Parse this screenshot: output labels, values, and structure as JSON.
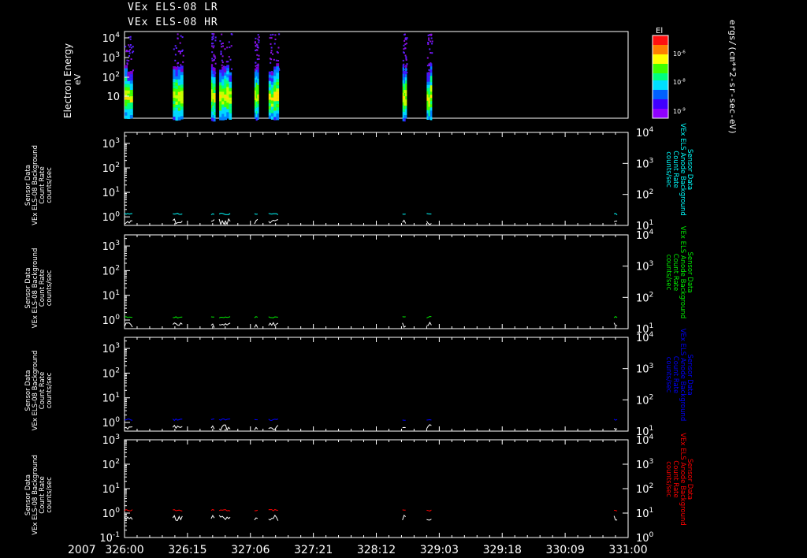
{
  "header": {
    "line1": "VEx ELS-08 LR",
    "line2": "VEx ELS-08 HR"
  },
  "colors": {
    "background": "#000000",
    "axis": "#ffffff",
    "cyan": "#00ffff",
    "green": "#00ee00",
    "blue": "#0000ff",
    "red": "#ff0000"
  },
  "chart_data": [
    {
      "type": "heatmap",
      "ylabel": "Electron Energy",
      "yunit": "eV",
      "scale": "log",
      "yticks": [
        "10",
        "10^2",
        "10^3",
        "10^4"
      ],
      "colorbar": {
        "title": "El",
        "units": "ergs/(cm**2-sr-sec-eV)",
        "ticks": [
          "10^-6",
          "10^-8",
          "10^-9"
        ]
      },
      "intervals": [
        [
          326.0,
          326.08
        ],
        [
          326.48,
          326.58
        ],
        [
          326.86,
          326.9
        ],
        [
          326.94,
          327.06
        ],
        [
          327.29,
          327.33
        ],
        [
          327.43,
          327.53
        ],
        [
          328.76,
          328.8
        ],
        [
          329.0,
          329.05
        ]
      ]
    },
    {
      "type": "line",
      "ylabel": [
        "Sensor Data",
        "VEx ELS-08 Background",
        "Count Rate",
        "counts/sec"
      ],
      "right_label": [
        "Sensor Data",
        "VEx ELS Anode Background",
        "Count Rate",
        "counts/sec"
      ],
      "left_ticks": [
        "10^0",
        "10^1",
        "10^2",
        "10^3"
      ],
      "right_ticks": [
        "10^1",
        "10^2",
        "10^3",
        "10^4"
      ],
      "series": [
        {
          "color": "cyan",
          "approx_value": 1.3
        },
        {
          "color": "white",
          "approx_value": 0.7
        }
      ]
    },
    {
      "type": "line",
      "ylabel": [
        "Sensor Data",
        "VEx ELS-08 Background",
        "Count Rate",
        "counts/sec"
      ],
      "right_label": [
        "Sensor Data",
        "VEx ELS Anode Background",
        "Count Rate",
        "counts/sec"
      ],
      "left_ticks": [
        "10^0",
        "10^1",
        "10^2",
        "10^3"
      ],
      "right_ticks": [
        "10^1",
        "10^2",
        "10^3",
        "10^4"
      ],
      "series": [
        {
          "color": "green",
          "approx_value": 1.3
        },
        {
          "color": "white",
          "approx_value": 0.7
        }
      ]
    },
    {
      "type": "line",
      "ylabel": [
        "Sensor Data",
        "VEx ELS-08 Background",
        "Count Rate",
        "counts/sec"
      ],
      "right_label": [
        "Sensor Data",
        "VEx ELS Anode Background",
        "Count Rate",
        "counts/sec"
      ],
      "left_ticks": [
        "10^0",
        "10^1",
        "10^2",
        "10^3"
      ],
      "right_ticks": [
        "10^1",
        "10^2",
        "10^3",
        "10^4"
      ],
      "series": [
        {
          "color": "blue",
          "approx_value": 1.3
        },
        {
          "color": "white",
          "approx_value": 0.7
        }
      ]
    },
    {
      "type": "line",
      "ylabel": [
        "Sensor Data",
        "VEx ELS-08 Background",
        "Count Rate",
        "counts/sec"
      ],
      "right_label": [
        "Sensor Data",
        "VEx ELS Anode Background",
        "Count Rate",
        "counts/sec"
      ],
      "left_ticks": [
        "10^-1",
        "10^0",
        "10^1",
        "10^2",
        "10^3"
      ],
      "right_ticks": [
        "10^0",
        "10^1",
        "10^2",
        "10^3",
        "10^4"
      ],
      "series": [
        {
          "color": "red",
          "approx_value": 1.3
        },
        {
          "color": "white",
          "approx_value": 0.7
        }
      ]
    }
  ],
  "xaxis": {
    "year": "2007",
    "ticks": [
      "326:00",
      "326:15",
      "327:06",
      "327:21",
      "328:12",
      "329:03",
      "329:18",
      "330:09",
      "331:00"
    ]
  }
}
